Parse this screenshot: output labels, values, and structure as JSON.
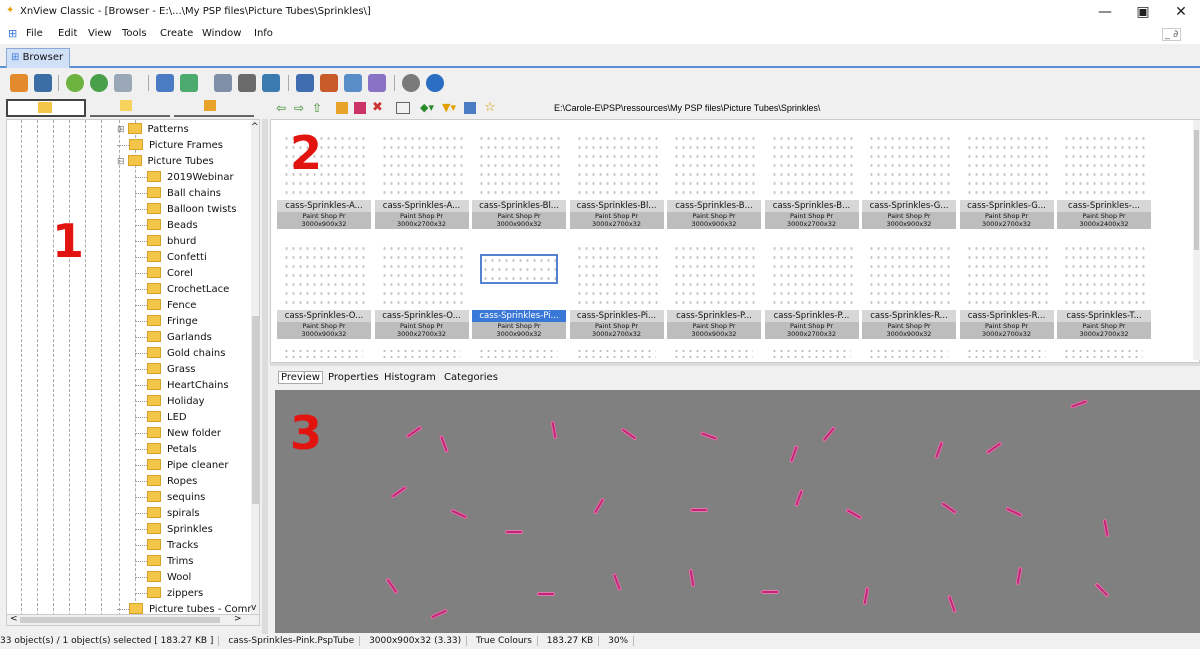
{
  "window": {
    "title": "XnView Classic - [Browser - E:\\...\\My PSP files\\Picture Tubes\\Sprinkles\\]",
    "minimize": "—",
    "maximize": "▣",
    "close": "✕",
    "restore_small": "_ ∂"
  },
  "menu": [
    "File",
    "Edit",
    "View",
    "Tools",
    "Create",
    "Window",
    "Info"
  ],
  "tabs": {
    "browser": "Browser"
  },
  "address": {
    "path": "E:\\Carole-E\\PSP\\ressources\\My PSP files\\Picture Tubes\\Sprinkles\\"
  },
  "tree": {
    "items": [
      {
        "label": "Patterns",
        "level": 1,
        "expander": "⊞"
      },
      {
        "label": "Picture Frames",
        "level": 1,
        "expander": ""
      },
      {
        "label": "Picture Tubes",
        "level": 1,
        "expander": "⊟"
      },
      {
        "label": "2019Webinar",
        "level": 2
      },
      {
        "label": "Ball chains",
        "level": 2
      },
      {
        "label": "Balloon twists",
        "level": 2
      },
      {
        "label": "Beads",
        "level": 2
      },
      {
        "label": "bhurd",
        "level": 2
      },
      {
        "label": "Confetti",
        "level": 2
      },
      {
        "label": "Corel",
        "level": 2
      },
      {
        "label": "CrochetLace",
        "level": 2
      },
      {
        "label": "Fence",
        "level": 2
      },
      {
        "label": "Fringe",
        "level": 2
      },
      {
        "label": "Garlands",
        "level": 2
      },
      {
        "label": "Gold chains",
        "level": 2
      },
      {
        "label": "Grass",
        "level": 2
      },
      {
        "label": "HeartChains",
        "level": 2
      },
      {
        "label": "Holiday",
        "level": 2
      },
      {
        "label": "LED",
        "level": 2
      },
      {
        "label": "New folder",
        "level": 2
      },
      {
        "label": "Petals",
        "level": 2
      },
      {
        "label": "Pipe cleaner",
        "level": 2
      },
      {
        "label": "Ropes",
        "level": 2
      },
      {
        "label": "sequins",
        "level": 2
      },
      {
        "label": "spirals",
        "level": 2
      },
      {
        "label": "Sprinkles",
        "level": 2
      },
      {
        "label": "Tracks",
        "level": 2
      },
      {
        "label": "Trims",
        "level": 2
      },
      {
        "label": "Wool",
        "level": 2
      },
      {
        "label": "zippers",
        "level": 2
      },
      {
        "label": "Picture tubes - Comm",
        "level": 1,
        "expander": ""
      }
    ],
    "scroll_up": "^",
    "scroll_down": "v",
    "scroll_left": "<",
    "scroll_right": ">"
  },
  "thumbnails": {
    "rows": [
      [
        {
          "name": "cass-Sprinkles-A...",
          "meta1": "Paint Shop Pr",
          "meta2": "3000x900x32"
        },
        {
          "name": "cass-Sprinkles-A...",
          "meta1": "Paint Shop Pr",
          "meta2": "3000x2700x32"
        },
        {
          "name": "cass-Sprinkles-Bl...",
          "meta1": "Paint Shop Pr",
          "meta2": "3000x900x32"
        },
        {
          "name": "cass-Sprinkles-Bl...",
          "meta1": "Paint Shop Pr",
          "meta2": "3000x2700x32"
        },
        {
          "name": "cass-Sprinkles-B...",
          "meta1": "Paint Shop Pr",
          "meta2": "3000x900x32"
        },
        {
          "name": "cass-Sprinkles-B...",
          "meta1": "Paint Shop Pr",
          "meta2": "3000x2700x32"
        },
        {
          "name": "cass-Sprinkles-G...",
          "meta1": "Paint Shop Pr",
          "meta2": "3000x900x32"
        },
        {
          "name": "cass-Sprinkles-G...",
          "meta1": "Paint Shop Pr",
          "meta2": "3000x2700x32"
        },
        {
          "name": "cass-Sprinkles-...",
          "meta1": "Paint Shop Pr",
          "meta2": "3000x2400x32"
        }
      ],
      [
        {
          "name": "cass-Sprinkles-O...",
          "meta1": "Paint Shop Pr",
          "meta2": "3000x900x32"
        },
        {
          "name": "cass-Sprinkles-O...",
          "meta1": "Paint Shop Pr",
          "meta2": "3000x2700x32"
        },
        {
          "name": "cass-Sprinkles-Pi...",
          "meta1": "Paint Shop Pr",
          "meta2": "3000x900x32",
          "selected": true
        },
        {
          "name": "cass-Sprinkles-Pi...",
          "meta1": "Paint Shop Pr",
          "meta2": "3000x2700x32"
        },
        {
          "name": "cass-Sprinkles-P...",
          "meta1": "Paint Shop Pr",
          "meta2": "3000x900x32"
        },
        {
          "name": "cass-Sprinkles-P...",
          "meta1": "Paint Shop Pr",
          "meta2": "3000x2700x32"
        },
        {
          "name": "cass-Sprinkles-R...",
          "meta1": "Paint Shop Pr",
          "meta2": "3000x900x32"
        },
        {
          "name": "cass-Sprinkles-R...",
          "meta1": "Paint Shop Pr",
          "meta2": "3000x2700x32"
        },
        {
          "name": "cass-Sprinkles-T...",
          "meta1": "Paint Shop Pr",
          "meta2": "3000x2700x32"
        }
      ]
    ]
  },
  "preview_tabs": [
    "Preview",
    "Properties",
    "Histogram",
    "Categories"
  ],
  "annotations": {
    "n1": "1",
    "n2": "2",
    "n3": "3"
  },
  "status": {
    "selection": "33 object(s) / 1 object(s) selected  [ 183.27 KB ]",
    "filename": "cass-Sprinkles-Pink.PspTube",
    "dimensions": "3000x900x32 (3.33)",
    "colours": "True Colours",
    "size": "183.27 KB",
    "zoom": "30%"
  },
  "colors": {
    "accent": "#5d8fd6",
    "selection": "#3a78d8",
    "annotation": "#e1140f",
    "sprinkle": "#c2267a",
    "preview_bg": "#808080"
  }
}
